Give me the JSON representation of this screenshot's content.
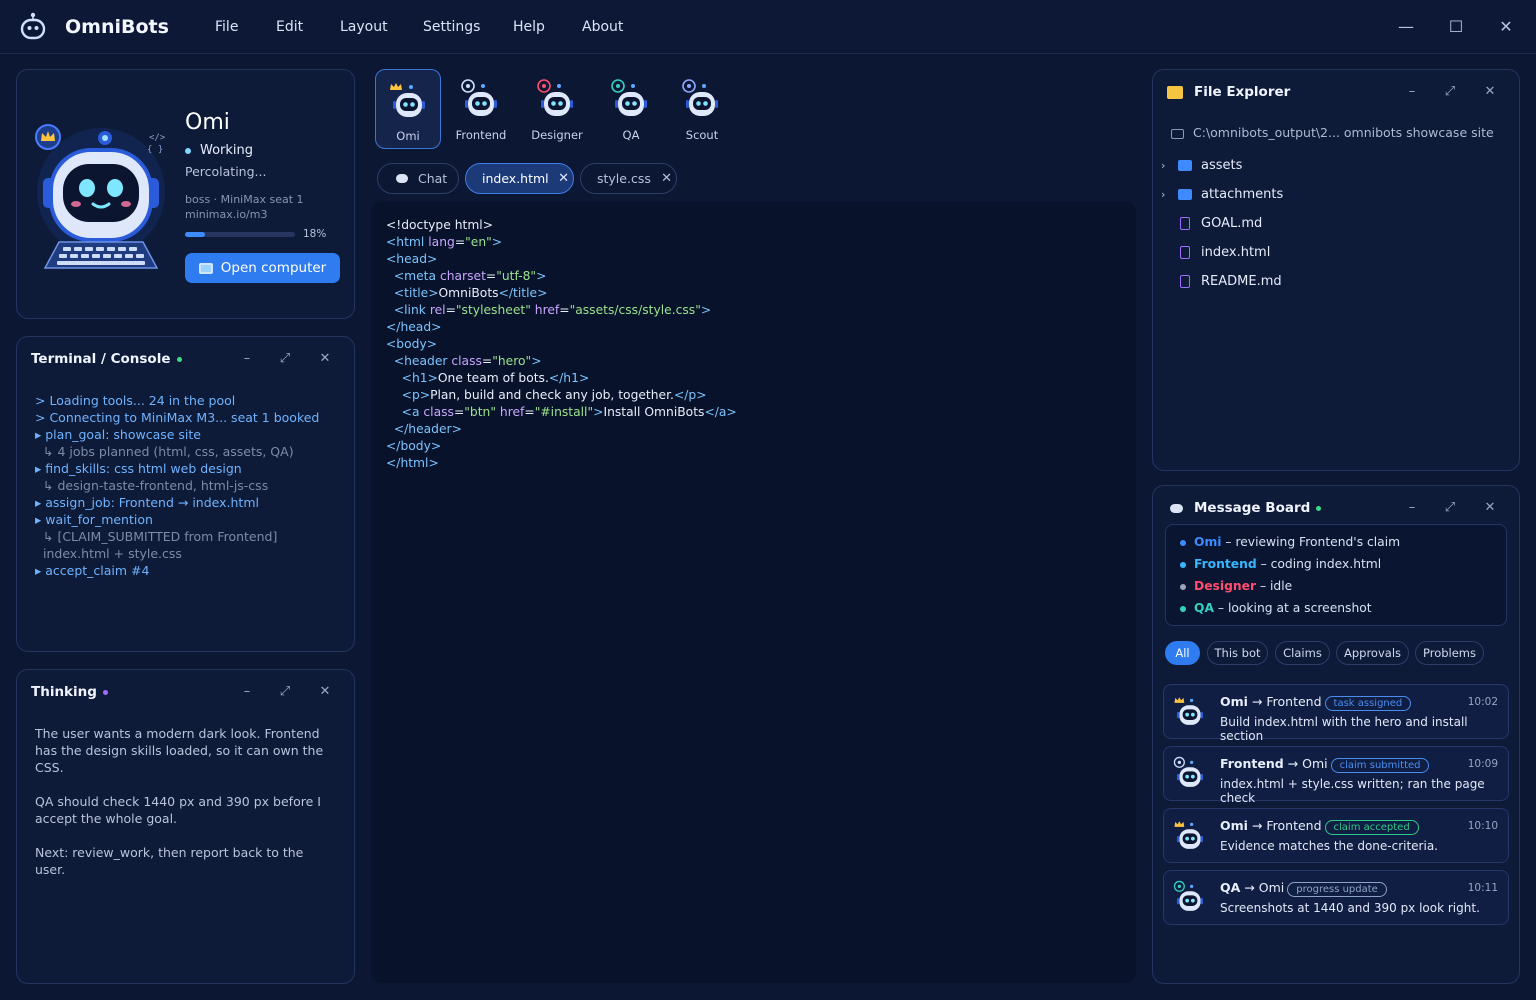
{
  "app": {
    "title": "OmniBots"
  },
  "menu": [
    "File",
    "Edit",
    "Layout",
    "Settings",
    "Help",
    "About"
  ],
  "window_controls": {
    "minimize": "—",
    "maximize": "☐",
    "close": "✕"
  },
  "profile": {
    "name": "Omi",
    "status": "Working",
    "substatus": "Percolating...",
    "meta_line1": "boss · MiniMax seat 1",
    "meta_line2": "minimax.io/m3",
    "progress_percent": 18,
    "progress_label": "18%",
    "open_button": "Open computer"
  },
  "terminal": {
    "title": "Terminal / Console",
    "lines": [
      {
        "kind": "cmd",
        "text": "> Loading tools... 24 in the pool"
      },
      {
        "kind": "cmd",
        "text": "> Connecting to MiniMax M3... seat 1 booked"
      },
      {
        "kind": "cmd",
        "text": "▸ plan_goal: showcase site"
      },
      {
        "kind": "sub",
        "text": "↳ 4 jobs planned (html, css, assets, QA)"
      },
      {
        "kind": "cmd",
        "text": "▸ find_skills: css html web design"
      },
      {
        "kind": "sub",
        "text": "↳ design-taste-frontend, html-js-css"
      },
      {
        "kind": "cmd",
        "text": "▸ assign_job: Frontend → index.html"
      },
      {
        "kind": "cmd",
        "text": "▸ wait_for_mention"
      },
      {
        "kind": "sub",
        "text": "↳ [CLAIM_SUBMITTED from Frontend] index.html + style.css"
      },
      {
        "kind": "cmd",
        "text": "▸ accept_claim #4"
      }
    ]
  },
  "thinking": {
    "title": "Thinking",
    "paragraphs": [
      "The user wants a modern dark look. Frontend has the design skills loaded, so it can own the CSS.",
      "QA should check 1440 px and 390 px before I accept the whole goal.",
      "Next: review_work, then report back to the user."
    ]
  },
  "bots": [
    {
      "label": "Omi",
      "active": true
    },
    {
      "label": "Frontend",
      "active": false
    },
    {
      "label": "Designer",
      "active": false
    },
    {
      "label": "QA",
      "active": false
    },
    {
      "label": "Scout",
      "active": false
    }
  ],
  "tabs": {
    "chat": "Chat",
    "files": [
      "index.html",
      "style.css"
    ],
    "close_glyph": "✕"
  },
  "editor": {
    "lines": [
      "<!doctype html>",
      "<html lang=\"en\">",
      "<head>",
      "  <meta charset=\"utf-8\">",
      "  <title>OmniBots</title>",
      "  <link rel=\"stylesheet\" href=\"assets/css/style.css\">",
      "</head>",
      "<body>",
      "  <header class=\"hero\">",
      "    <h1>One team of bots.</h1>",
      "    <p>Plan, build and check any job, together.</p>",
      "    <a class=\"btn\" href=\"#install\">Install OmniBots</a>",
      "  </header>",
      "</body>",
      "</html>"
    ]
  },
  "file_explorer": {
    "title": "File Explorer",
    "path": "C:\\omnibots_output\\2... omnibots showcase site",
    "items": [
      {
        "name": "assets",
        "type": "folder"
      },
      {
        "name": "attachments",
        "type": "folder"
      },
      {
        "name": "GOAL.md",
        "type": "file"
      },
      {
        "name": "index.html",
        "type": "file"
      },
      {
        "name": "README.md",
        "type": "file"
      }
    ]
  },
  "message_board": {
    "title": "Message Board",
    "statuses": [
      {
        "bot": "Omi",
        "text": " – reviewing Frontend's claim",
        "color": "#3d8bff"
      },
      {
        "bot": "Frontend",
        "text": " – coding index.html",
        "color": "#38b6ff"
      },
      {
        "bot": "Designer",
        "text": " – idle",
        "color": "#ff4d6d"
      },
      {
        "bot": "QA",
        "text": " – looking at a screenshot",
        "color": "#35d0c0"
      }
    ],
    "filters": [
      "All",
      "This bot",
      "Claims",
      "Approvals",
      "Problems"
    ],
    "messages": [
      {
        "from": "Omi",
        "to": "Frontend",
        "badge": "task assigned",
        "badge_color": "#4a8df0",
        "time": "10:02",
        "body": "Build index.html with the hero and install section"
      },
      {
        "from": "Frontend",
        "to": "Omi",
        "badge": "claim submitted",
        "badge_color": "#4a8df0",
        "time": "10:09",
        "body": "index.html + style.css written; ran the page check"
      },
      {
        "from": "Omi",
        "to": "Frontend",
        "badge": "claim accepted",
        "badge_color": "#2fc98a",
        "time": "10:10",
        "body": "Evidence matches the done-criteria."
      },
      {
        "from": "QA",
        "to": "Omi",
        "badge": "progress update",
        "badge_color": "#8da2c9",
        "time": "10:11",
        "body": "Screenshots at 1440 and 390 px look right."
      }
    ]
  },
  "colors": {
    "accent": "#2f7cf0",
    "background": "#0b1733",
    "panel": "#0d1a38",
    "status_green": "#3ddc84",
    "thinking_purple": "#a06bff"
  }
}
